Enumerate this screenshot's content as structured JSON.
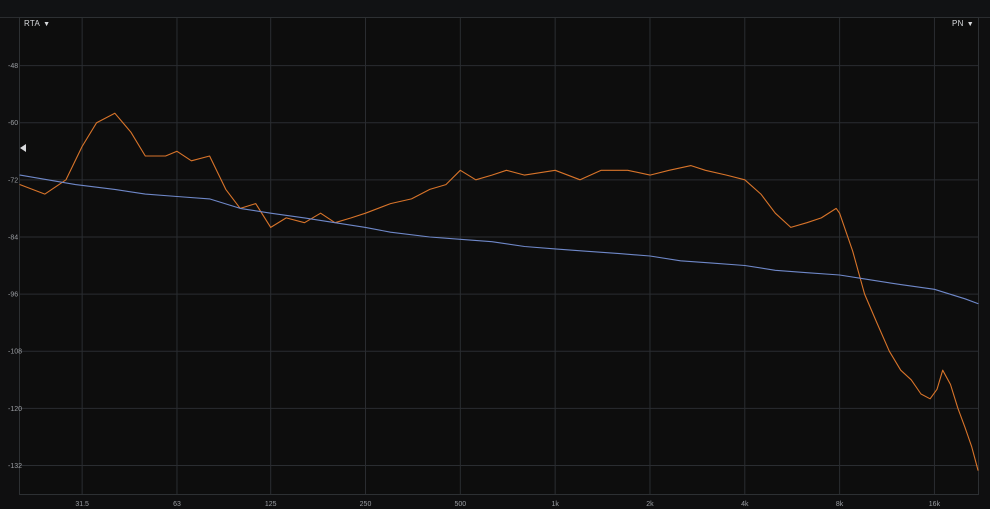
{
  "toolbar": {
    "rta_label": "RTA",
    "pn_label": "PN",
    "caret_glyph": "▼"
  },
  "colors": {
    "background": "#0f0f10",
    "grid": "#2a2d31",
    "text": "#9b9ea3",
    "series_orange": "#d8742a",
    "series_blue": "#6f88c9"
  },
  "chart_data": {
    "type": "line",
    "x_scale": "log",
    "xlim": [
      20,
      22000
    ],
    "ylim": [
      -138,
      -38
    ],
    "grid": true,
    "x_tick_labels": [
      {
        "label": "31.5",
        "value": 31.5
      },
      {
        "label": "63",
        "value": 63
      },
      {
        "label": "125",
        "value": 125
      },
      {
        "label": "250",
        "value": 250
      },
      {
        "label": "500",
        "value": 500
      },
      {
        "label": "1k",
        "value": 1000
      },
      {
        "label": "2k",
        "value": 2000
      },
      {
        "label": "4k",
        "value": 4000
      },
      {
        "label": "8k",
        "value": 8000
      },
      {
        "label": "16k",
        "value": 16000
      }
    ],
    "y_ticks": [
      -48,
      -60,
      -72,
      -84,
      -96,
      -108,
      -120,
      -132
    ],
    "series": [
      {
        "color": "#d8742a",
        "x": [
          20,
          24,
          28,
          31.5,
          35,
          40,
          45,
          50,
          58,
          63,
          70,
          80,
          90,
          100,
          112,
          125,
          140,
          160,
          180,
          200,
          225,
          250,
          300,
          350,
          400,
          450,
          500,
          560,
          630,
          700,
          800,
          1000,
          1200,
          1400,
          1700,
          2000,
          2300,
          2700,
          3000,
          3500,
          4000,
          4500,
          5000,
          5600,
          6300,
          7000,
          7800,
          8000,
          8800,
          9600,
          10500,
          11500,
          12500,
          13500,
          14500,
          15500,
          16300,
          17000,
          18000,
          19000,
          20000,
          21000,
          22000
        ],
        "y": [
          -73,
          -75,
          -72,
          -65,
          -60,
          -58,
          -62,
          -67,
          -67,
          -66,
          -68,
          -67,
          -74,
          -78,
          -77,
          -82,
          -80,
          -81,
          -79,
          -81,
          -80,
          -79,
          -77,
          -76,
          -74,
          -73,
          -70,
          -72,
          -71,
          -70,
          -71,
          -70,
          -72,
          -70,
          -70,
          -71,
          -70,
          -69,
          -70,
          -71,
          -72,
          -75,
          -79,
          -82,
          -81,
          -80,
          -78,
          -79,
          -87,
          -96,
          -102,
          -108,
          -112,
          -114,
          -117,
          -118,
          -116,
          -112,
          -115,
          -120,
          -124,
          -128,
          -133
        ]
      },
      {
        "color": "#6f88c9",
        "x": [
          20,
          30,
          40,
          50,
          63,
          80,
          100,
          125,
          160,
          200,
          250,
          300,
          400,
          500,
          630,
          800,
          1000,
          1250,
          1600,
          2000,
          2500,
          3150,
          4000,
          5000,
          6300,
          8000,
          10000,
          12500,
          16000,
          20000,
          22000
        ],
        "y": [
          -71,
          -73,
          -74,
          -75,
          -75.5,
          -76,
          -78,
          -79,
          -80,
          -81,
          -82,
          -83,
          -84,
          -84.5,
          -85,
          -86,
          -86.5,
          -87,
          -87.5,
          -88,
          -89,
          -89.5,
          -90,
          -91,
          -91.5,
          -92,
          -93,
          -94,
          -95,
          -97,
          -98
        ]
      }
    ]
  }
}
